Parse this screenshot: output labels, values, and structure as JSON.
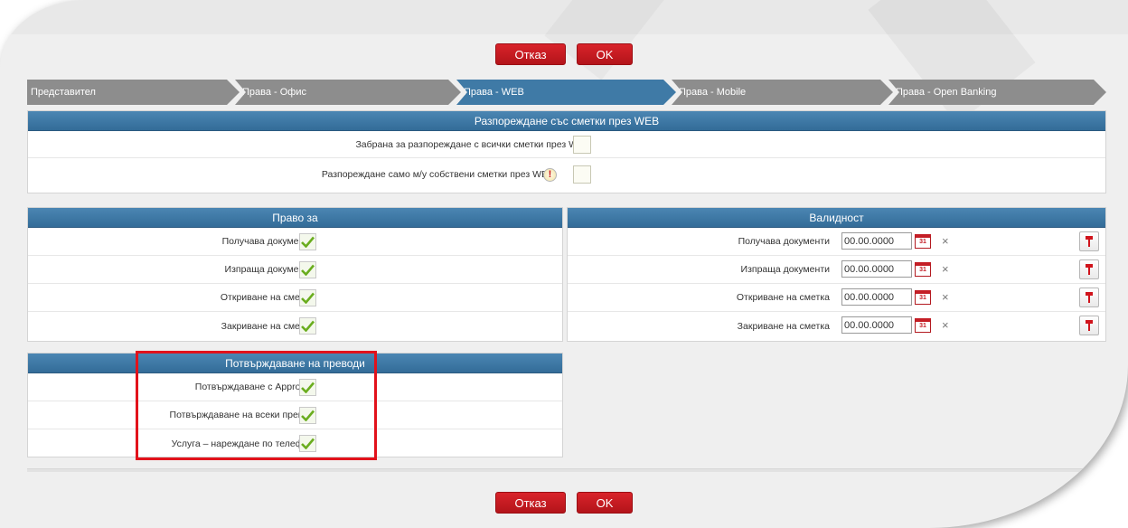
{
  "buttons": {
    "cancel": "Отказ",
    "ok": "OK"
  },
  "wizard": {
    "steps": [
      {
        "label": "Представител",
        "active": false
      },
      {
        "label": "Права - Офис",
        "active": false
      },
      {
        "label": "Права - WEB",
        "active": true
      },
      {
        "label": "Права - Mobile",
        "active": false
      },
      {
        "label": "Права - Open Banking",
        "active": false
      }
    ]
  },
  "web_panel": {
    "title": "Разпореждане със сметки през WEB",
    "rows": [
      {
        "label": "Забрана за разпореждане с всички сметки през WEB",
        "checked": false
      },
      {
        "label": "Разпореждане само м/у собствени сметки през WEB",
        "checked": false,
        "warning_icon": "!"
      }
    ]
  },
  "rights_panel": {
    "title": "Право за",
    "rows": [
      {
        "label": "Получава документи",
        "checked": true
      },
      {
        "label": "Изпраща документи",
        "checked": true
      },
      {
        "label": "Откриване на сметка",
        "checked": true
      },
      {
        "label": "Закриване на сметка",
        "checked": true
      }
    ]
  },
  "validity_panel": {
    "title": "Валидност",
    "rows": [
      {
        "label": "Получава документи",
        "date": "00.00.0000"
      },
      {
        "label": "Изпраща документи",
        "date": "00.00.0000"
      },
      {
        "label": "Откриване на сметка",
        "date": "00.00.0000"
      },
      {
        "label": "Закриване на сметка",
        "date": "00.00.0000"
      }
    ],
    "calendar_text": "31",
    "clear_symbol": "×"
  },
  "confirm_panel": {
    "title": "Потвърждаване на преводи",
    "rows": [
      {
        "label": "Потвърждаване с Approver",
        "checked": true
      },
      {
        "label": "Потвърждаване на всеки превод",
        "checked": true
      },
      {
        "label": "Услуга – нареждане по телефон",
        "checked": true
      }
    ]
  },
  "colors": {
    "accent_red": "#c41e26",
    "header_blue": "#3f7aa6",
    "step_gray": "#8d8d8d",
    "highlight": "#e2121b"
  }
}
